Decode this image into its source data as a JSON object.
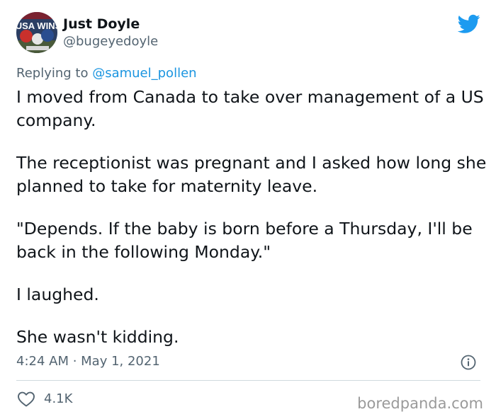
{
  "author": {
    "name": "Just Doyle",
    "handle": "@bugeyedoyle",
    "avatar_text": "USA WINS"
  },
  "reply": {
    "prefix": "Replying to ",
    "mention": "@samuel_pollen"
  },
  "tweet": {
    "paragraphs": [
      "I moved from Canada to take over management of a US company.",
      "The receptionist was pregnant and I asked how long she planned to take for maternity leave.",
      "\"Depends. If the baby is born before a Thursday, I'll be back in the following Monday.\"",
      "I laughed.",
      "She wasn't kidding."
    ],
    "timestamp": "4:24 AM · May 1, 2021"
  },
  "actions": {
    "likes": "4.1K"
  },
  "watermark": "boredpanda.com",
  "colors": {
    "twitter_blue": "#1d9bf0",
    "mention_blue": "#1b95e0",
    "secondary_text": "#536471"
  },
  "icons": [
    "twitter-bird-icon",
    "info-icon",
    "heart-icon"
  ]
}
